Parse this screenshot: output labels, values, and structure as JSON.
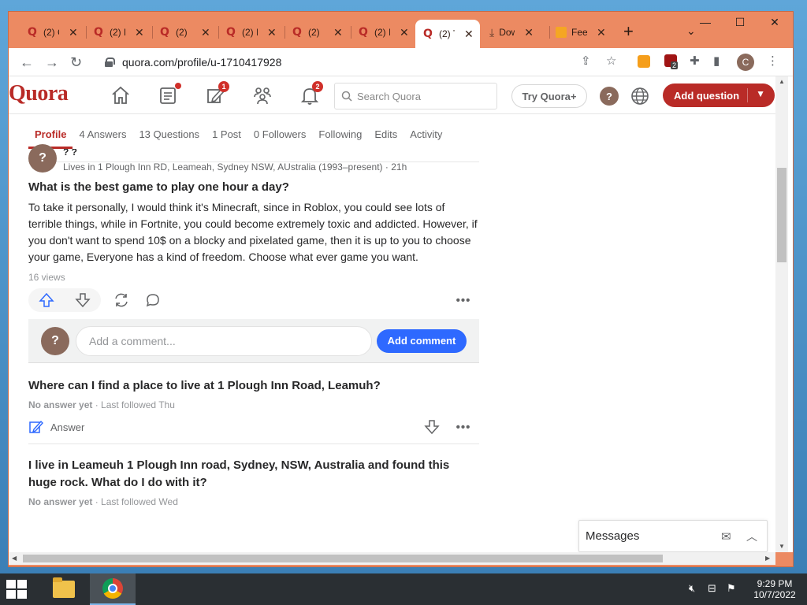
{
  "browser": {
    "tabs": [
      {
        "title": "(2) C",
        "kind": "quora"
      },
      {
        "title": "(2) F",
        "kind": "quora"
      },
      {
        "title": "(2)",
        "kind": "quora"
      },
      {
        "title": "(2) I",
        "kind": "quora"
      },
      {
        "title": "(2)",
        "kind": "quora"
      },
      {
        "title": "(2) I",
        "kind": "quora"
      },
      {
        "title": "(2) T",
        "kind": "quora",
        "active": true
      },
      {
        "title": "Dow",
        "kind": "download"
      },
      {
        "title": "Fee",
        "kind": "feed"
      }
    ],
    "new_tab": "+",
    "url": "quora.com/profile/u-1710417928",
    "profile_initial": "C",
    "extension_badge": "2"
  },
  "quora": {
    "logo": "Quora",
    "notif_count_answer": "1",
    "notif_count_bell": "2",
    "search_placeholder": "Search Quora",
    "try_plus": "Try Quora+",
    "help": "?",
    "add_question": "Add question",
    "profile_tabs": [
      {
        "label": "Profile",
        "active": true
      },
      {
        "label": "4 Answers"
      },
      {
        "label": "13 Questions"
      },
      {
        "label": "1 Post"
      },
      {
        "label": "0 Followers"
      },
      {
        "label": "Following"
      },
      {
        "label": "Edits"
      },
      {
        "label": "Activity"
      }
    ]
  },
  "answer": {
    "author_name": "? ?",
    "credential": "Lives in 1 Plough Inn RD, Leameah, Sydney NSW, AUstralia (1993–present) · 21h",
    "question": "What is the best game to play one hour a day?",
    "body": "To take it personally, I would think it's Minecraft, since in Roblox, you could see lots of terrible things, while in Fortnite, you could become extremely toxic and addicted. However, if you don't want to spend 10$ on a blocky and pixelated game, then it is up to you to choose your game, Everyone has a kind of freedom. Choose what ever game you want.",
    "views": "16 views",
    "comment_placeholder": "Add a comment...",
    "comment_button": "Add comment",
    "avatar": "?"
  },
  "questions": [
    {
      "title": "Where can I find a place to live at 1 Plough Inn Road, Leamuh?",
      "status": "No answer yet",
      "followed": " · Last followed Thu",
      "answer_label": "Answer"
    },
    {
      "title": "I live in Leameuh 1 Plough Inn road, Sydney, NSW, Australia and found this huge rock. What do I do with it?",
      "status": "No answer yet",
      "followed": " · Last followed Wed"
    }
  ],
  "messages": {
    "label": "Messages"
  },
  "taskbar": {
    "time": "9:29 PM",
    "date": "10/7/2022"
  },
  "colors": {
    "quora_red": "#b92b27",
    "comment_blue": "#2e69ff",
    "browser_frame": "#ec8a62"
  }
}
